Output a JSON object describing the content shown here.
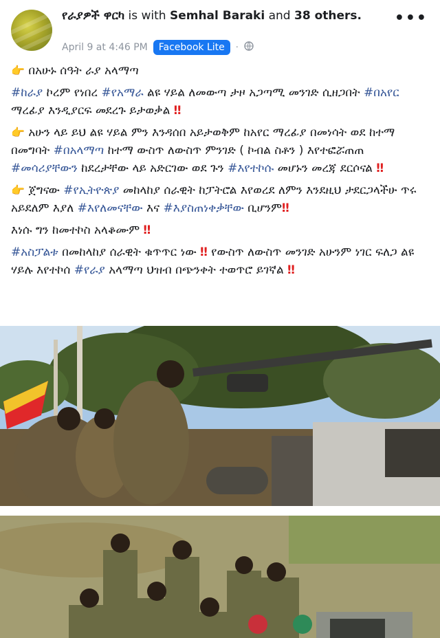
{
  "post": {
    "author": "የራያዎች ዋርካ",
    "with_text": "is with",
    "tagged": "Semhal Baraki",
    "and_text": "and",
    "others": "38 others.",
    "date": "April 9 at 4:46 PM",
    "app_badge": "Facebook Lite",
    "more_label": "•••"
  },
  "content": {
    "line1": "በአሁኑ ሰዓት ራያ አላማጣ",
    "p2": {
      "tag1": "#ከራያ",
      "t1": " ኮረም የነበረ ",
      "tag2": "#የአማራ",
      "t2": " ልዩ ሃይል ለመውጣ ታዞ አጋጣሚ መንገድ ሲዘጋበት ",
      "tag3": "#በአየር",
      "t3": " ማረፊያ እንዲያርፍ መደረጉ ይታወቃል"
    },
    "p3": {
      "t1": "አሁን ላይ ይህ ልዩ ሃይል ምን እንዳሰበ አይታወቅም ከአየር ማረፊያ በመነሳት ወደ ከተማ በመግባት ",
      "tag1": "#በአላማጣ",
      "t2": " ከተማ ውስጥ ለውስጥ ምንገድ ( ኮብል ስቶን ) እየተፎሯጠጠ ",
      "tag2": "#መሳሪያቸውን",
      "t3": " ከደረታቸው ላይ አድርገው ወደ ጉን ",
      "tag3": "#እየተኮሱ",
      "t4": " መሆኑን መረጃ ደርሶናል"
    },
    "p4": {
      "t1": "ጀግናው ",
      "tag1": "#የኢትዮጵያ",
      "t2": " መከላከያ ሰራዊት ከፓትሮል እየወረደ ለምን እንደዚህ ታደርጋላችሁ ጥሩ አይደለም እያለ ",
      "tag2": "#እየለመናቸው",
      "t3": " እና ",
      "tag3": "#እያስጠነቀቃቸው",
      "t4": " ቢሆንም"
    },
    "p5": "እነሱ ግን ከመተኮስ አላቆሙም",
    "p6": {
      "tag1": "#አስፓልቱ",
      "t1": " በመከላከያ ሰራዊት ቁጥጥር ነው ",
      "t2": " የውስጥ ለውስጥ መንገድ አሁንም ነገር ፍለጋ ልዩ ሃይሉ እየተኮሰ ",
      "tag2": "#የራያ",
      "t3": " አላማጣ ህዝብ በጭንቀት ተወጥሮ ይገኛል"
    },
    "exclaim": "‼",
    "pointing_emoji": "👉"
  },
  "colors": {
    "link": "#385898",
    "badge": "#1877f2",
    "meta": "#8d949e",
    "alert": "#e02020"
  },
  "icons": [
    "pointing-hand-icon",
    "double-exclamation-icon",
    "globe-icon",
    "more-icon"
  ]
}
